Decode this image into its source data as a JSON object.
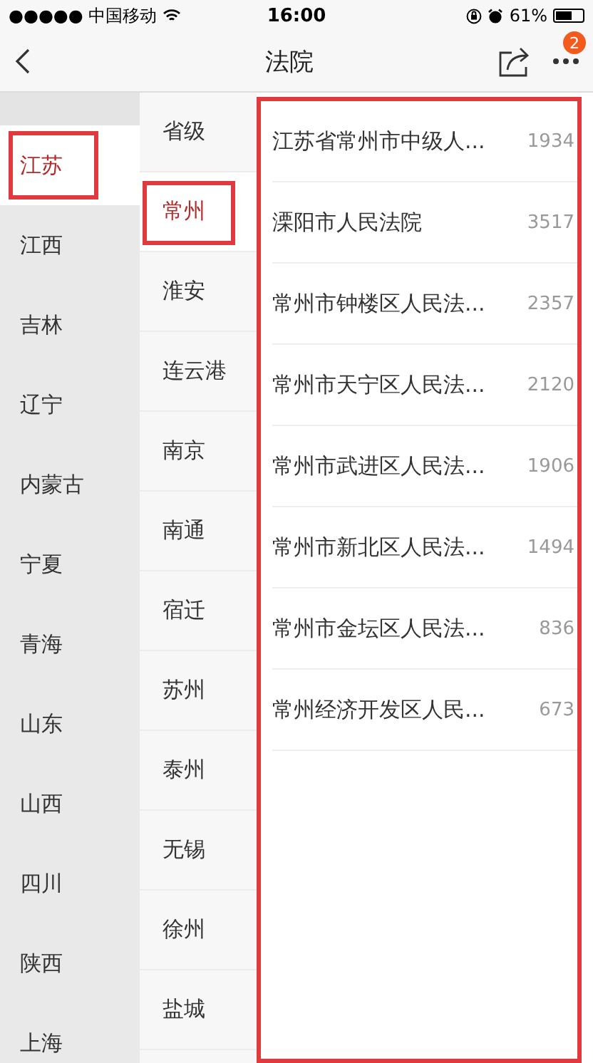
{
  "status_bar": {
    "carrier": "●●●●● 中国移动",
    "time": "16:00",
    "battery_text": "61%"
  },
  "nav_bar": {
    "title": "法院",
    "badge": "2"
  },
  "provinces": [
    {
      "label": "江苏",
      "selected": true,
      "outlined": true
    },
    {
      "label": "江西",
      "selected": false,
      "outlined": false
    },
    {
      "label": "吉林",
      "selected": false,
      "outlined": false
    },
    {
      "label": "辽宁",
      "selected": false,
      "outlined": false
    },
    {
      "label": "内蒙古",
      "selected": false,
      "outlined": false
    },
    {
      "label": "宁夏",
      "selected": false,
      "outlined": false
    },
    {
      "label": "青海",
      "selected": false,
      "outlined": false
    },
    {
      "label": "山东",
      "selected": false,
      "outlined": false
    },
    {
      "label": "山西",
      "selected": false,
      "outlined": false
    },
    {
      "label": "四川",
      "selected": false,
      "outlined": false
    },
    {
      "label": "陕西",
      "selected": false,
      "outlined": false
    },
    {
      "label": "上海",
      "selected": false,
      "outlined": false
    }
  ],
  "cities": [
    {
      "label": "省级",
      "selected": false,
      "outlined": false
    },
    {
      "label": "常州",
      "selected": true,
      "outlined": true
    },
    {
      "label": "淮安",
      "selected": false,
      "outlined": false
    },
    {
      "label": "连云港",
      "selected": false,
      "outlined": false
    },
    {
      "label": "南京",
      "selected": false,
      "outlined": false
    },
    {
      "label": "南通",
      "selected": false,
      "outlined": false
    },
    {
      "label": "宿迁",
      "selected": false,
      "outlined": false
    },
    {
      "label": "苏州",
      "selected": false,
      "outlined": false
    },
    {
      "label": "泰州",
      "selected": false,
      "outlined": false
    },
    {
      "label": "无锡",
      "selected": false,
      "outlined": false
    },
    {
      "label": "徐州",
      "selected": false,
      "outlined": false
    },
    {
      "label": "盐城",
      "selected": false,
      "outlined": false
    }
  ],
  "courts": {
    "outlined": true,
    "items": [
      {
        "name": "江苏省常州市中级人...",
        "count": "1934"
      },
      {
        "name": "溧阳市人民法院",
        "count": "3517"
      },
      {
        "name": "常州市钟楼区人民法...",
        "count": "2357"
      },
      {
        "name": "常州市天宁区人民法...",
        "count": "2120"
      },
      {
        "name": "常州市武进区人民法...",
        "count": "1906"
      },
      {
        "name": "常州市新北区人民法...",
        "count": "1494"
      },
      {
        "name": "常州市金坛区人民法...",
        "count": "836"
      },
      {
        "name": "常州经济开发区人民...",
        "count": "673"
      }
    ]
  }
}
